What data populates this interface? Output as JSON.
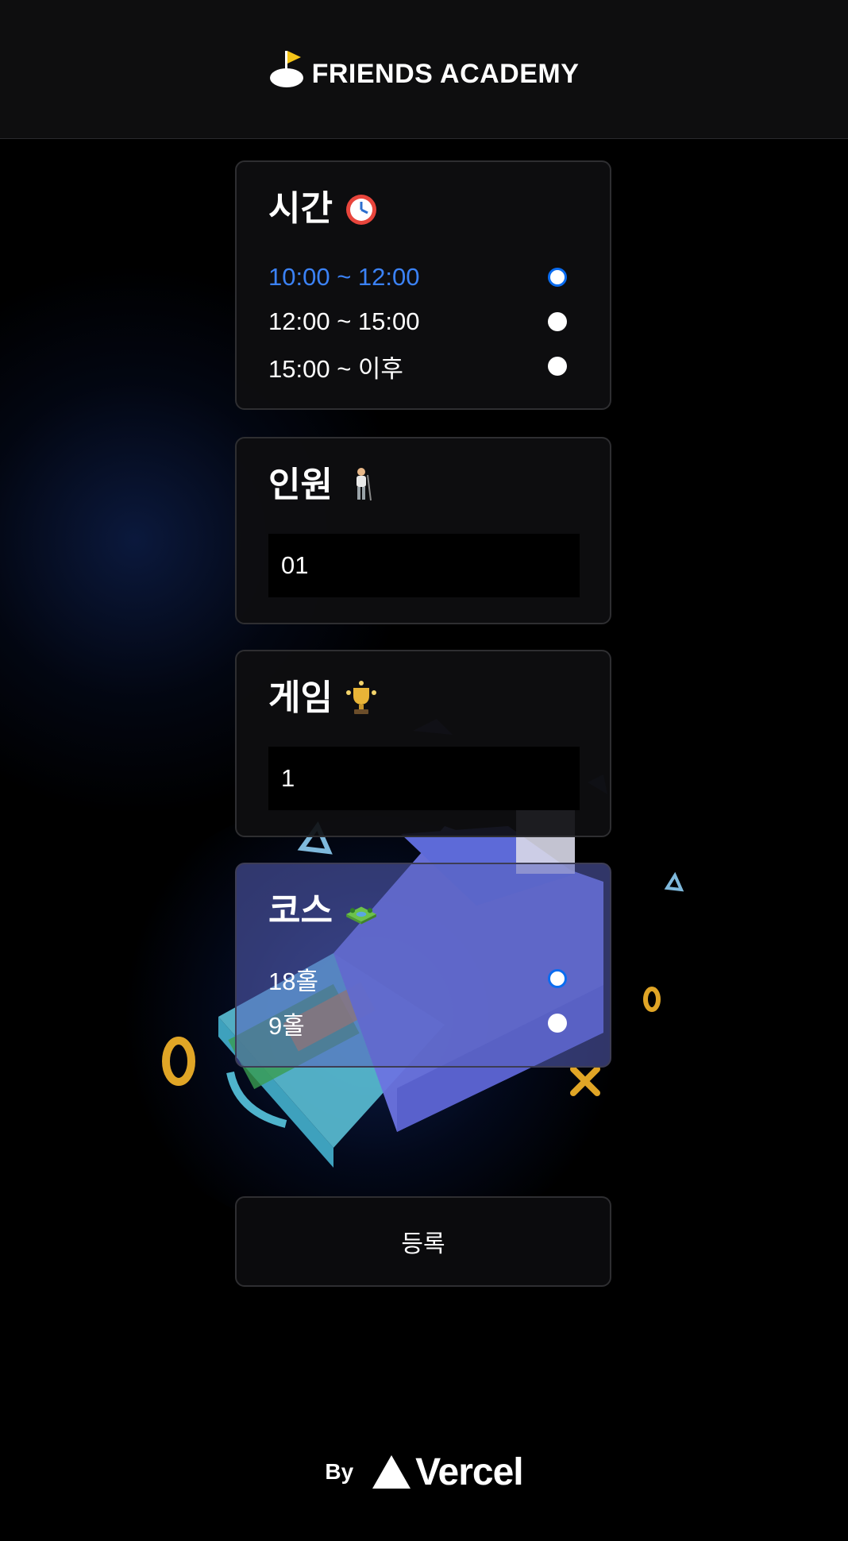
{
  "header": {
    "brand": "FRIENDS ACADEMY",
    "brand_flag_color": "#f5c518"
  },
  "time_section": {
    "title": "시간",
    "emoji": "alarm-clock-icon",
    "options": [
      {
        "label": "10:00 ~ 12:00",
        "selected": true
      },
      {
        "label": "12:00 ~ 15:00",
        "selected": false
      },
      {
        "label": "15:00 ~ 이후",
        "selected": false
      }
    ]
  },
  "people_section": {
    "title": "인원",
    "emoji": "golfer-icon",
    "value": "01"
  },
  "game_section": {
    "title": "게임",
    "emoji": "trophy-icon",
    "value": "1"
  },
  "course_section": {
    "title": "코스",
    "emoji": "golf-course-icon",
    "options": [
      {
        "label": "18홀",
        "selected": true
      },
      {
        "label": "9홀",
        "selected": false
      }
    ]
  },
  "submit": {
    "label": "등록"
  },
  "footer": {
    "by": "By",
    "brand": "Vercel"
  },
  "colors": {
    "accent": "#3b82f6",
    "background": "#000000",
    "card_border": "#2e2e31"
  }
}
